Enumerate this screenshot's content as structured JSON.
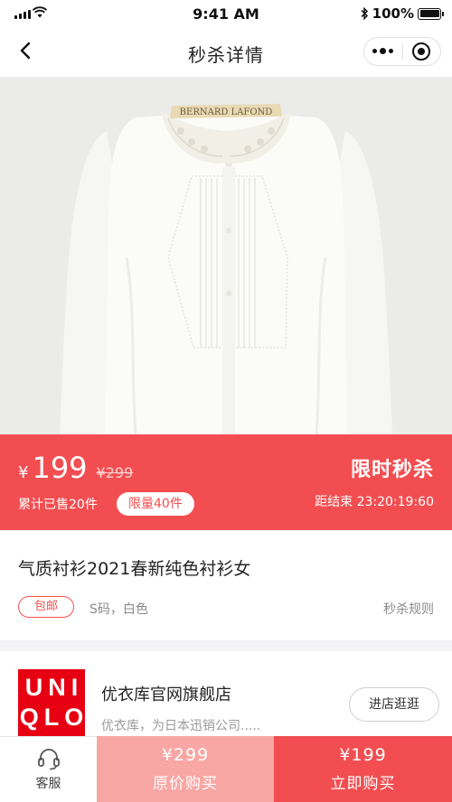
{
  "status_bar": {
    "time": "9:41 AM",
    "battery": "100%",
    "battery_level": 1.0
  },
  "nav": {
    "title": "秒杀详情",
    "back_icon": "chevron-left-icon",
    "more_icon": "more-dots-icon",
    "close_icon": "target-close-icon"
  },
  "product_image": {
    "label_text": "BERNARD LAFOND"
  },
  "sale": {
    "currency": "¥",
    "price": "199",
    "original_price": "¥299",
    "sold": "累计已售20件",
    "limit": "限量40件",
    "label": "限时秒杀",
    "countdown": "距结束 23:20:19:60",
    "color": "#f24e51"
  },
  "product": {
    "name": "气质衬衫2021春新纯色衬衫女",
    "tag": "包邮",
    "spec": "S码，白色",
    "rule_link": "秒杀规则"
  },
  "store": {
    "logo_lines": [
      "UNI",
      "QLO"
    ],
    "name": "优衣库官网旗舰店",
    "desc": "优衣库，为日本迅销公司.....",
    "visit": "进店逛逛",
    "logo_color": "#e60012"
  },
  "bottom_bar": {
    "service_icon": "headset-icon",
    "service_label": "客服",
    "original_price": "¥299",
    "original_label": "原价购买",
    "now_price": "¥199",
    "now_label": "立即购买"
  }
}
